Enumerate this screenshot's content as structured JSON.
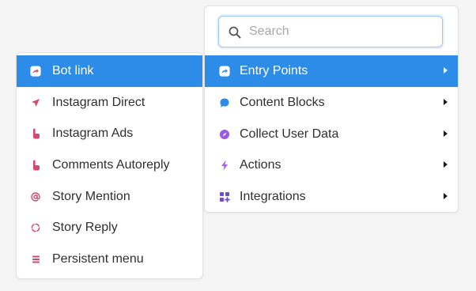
{
  "search": {
    "placeholder": "Search"
  },
  "main_menu": {
    "items": [
      {
        "label": "Entry Points",
        "icon": "entry-points-icon",
        "color": "#ffffff",
        "active": true,
        "has_submenu": true
      },
      {
        "label": "Content Blocks",
        "icon": "chat-bubble-icon",
        "color": "#2d8ce8",
        "has_submenu": true
      },
      {
        "label": "Collect User Data",
        "icon": "compass-icon",
        "color": "#9b59e6",
        "has_submenu": true
      },
      {
        "label": "Actions",
        "icon": "lightning-icon",
        "color": "#b05cf0",
        "has_submenu": true
      },
      {
        "label": "Integrations",
        "icon": "grid-plus-icon",
        "color": "#6b4fc9",
        "has_submenu": true
      }
    ]
  },
  "entry_submenu": {
    "items": [
      {
        "label": "Bot link",
        "icon": "bot-link-icon",
        "color": "#ffffff",
        "active": true
      },
      {
        "label": "Instagram Direct",
        "icon": "send-icon",
        "color": "#d34a6e"
      },
      {
        "label": "Instagram Ads",
        "icon": "hand-pointer-icon",
        "color": "#d34a6e"
      },
      {
        "label": "Comments Autoreply",
        "icon": "hand-pointer-icon",
        "color": "#d34a6e"
      },
      {
        "label": "Story Mention",
        "icon": "at-sign-icon",
        "color": "#d34a6e"
      },
      {
        "label": "Story Reply",
        "icon": "dashed-circle-icon",
        "color": "#d34a6e"
      },
      {
        "label": "Persistent menu",
        "icon": "menu-lines-icon",
        "color": "#d34a6e"
      }
    ]
  },
  "colors": {
    "accent": "#2d8ce8",
    "text": "#2f2f33",
    "instagram": "#d34a6e"
  }
}
